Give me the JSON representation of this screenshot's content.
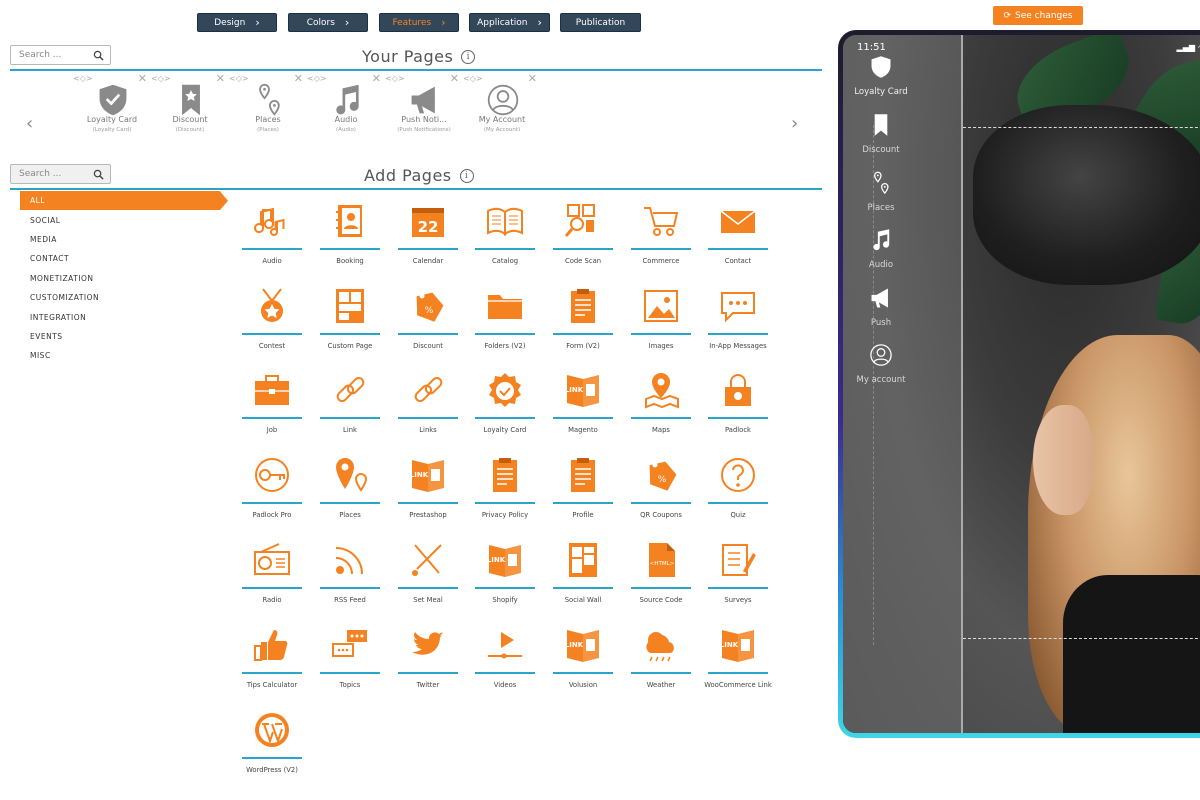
{
  "nav": {
    "steps": [
      {
        "label": "Design",
        "active": false
      },
      {
        "label": "Colors",
        "active": false
      },
      {
        "label": "Features",
        "active": true
      },
      {
        "label": "Application",
        "active": false
      },
      {
        "label": "Publication",
        "active": false
      }
    ],
    "see_changes": "See changes"
  },
  "search_top": {
    "placeholder": "Search ..."
  },
  "search_bottom": {
    "placeholder": "Search ..."
  },
  "your_pages": {
    "title": "Your Pages",
    "items": [
      {
        "label": "Loyalty Card",
        "sub": "(Loyalty Card)",
        "icon": "shield-check-icon"
      },
      {
        "label": "Discount",
        "sub": "(Discount)",
        "icon": "bookmark-star-icon"
      },
      {
        "label": "Places",
        "sub": "(Places)",
        "icon": "map-pins-icon"
      },
      {
        "label": "Audio",
        "sub": "(Audio)",
        "icon": "music-note-icon"
      },
      {
        "label": "Push Noti...",
        "sub": "(Push Notifications)",
        "icon": "megaphone-icon"
      },
      {
        "label": "My Account",
        "sub": "(My Account)",
        "icon": "user-circle-icon"
      }
    ]
  },
  "add_pages": {
    "title": "Add Pages",
    "categories": [
      "ALL",
      "SOCIAL",
      "MEDIA",
      "CONTACT",
      "MONETIZATION",
      "CUSTOMIZATION",
      "INTEGRATION",
      "EVENTS",
      "MISC"
    ],
    "active_category": "ALL",
    "tiles": [
      {
        "label": "Audio",
        "icon": "music-notes-icon"
      },
      {
        "label": "Booking",
        "icon": "address-book-icon"
      },
      {
        "label": "Calendar",
        "icon": "calendar-icon",
        "text": "22"
      },
      {
        "label": "Catalog",
        "icon": "open-book-icon"
      },
      {
        "label": "Code Scan",
        "icon": "qr-scan-icon"
      },
      {
        "label": "Commerce",
        "icon": "shopping-cart-icon"
      },
      {
        "label": "Contact",
        "icon": "envelope-icon"
      },
      {
        "label": "Contest",
        "icon": "medal-icon"
      },
      {
        "label": "Custom Page",
        "icon": "layout-icon"
      },
      {
        "label": "Discount",
        "icon": "price-tag-icon"
      },
      {
        "label": "Folders (V2)",
        "icon": "folder-icon"
      },
      {
        "label": "Form (V2)",
        "icon": "clipboard-form-icon"
      },
      {
        "label": "Images",
        "icon": "image-icon"
      },
      {
        "label": "In-App Messages",
        "icon": "chat-bubble-icon"
      },
      {
        "label": "Job",
        "icon": "briefcase-icon"
      },
      {
        "label": "Link",
        "icon": "chain-link-icon"
      },
      {
        "label": "Links",
        "icon": "chain-links-icon"
      },
      {
        "label": "Loyalty Card",
        "icon": "badge-check-icon"
      },
      {
        "label": "Magento",
        "icon": "magento-link-icon"
      },
      {
        "label": "Maps",
        "icon": "map-marker-icon"
      },
      {
        "label": "Padlock",
        "icon": "padlock-icon"
      },
      {
        "label": "Padlock Pro",
        "icon": "key-circle-icon"
      },
      {
        "label": "Places",
        "icon": "places-pin-icon"
      },
      {
        "label": "Prestashop",
        "icon": "prestashop-link-icon"
      },
      {
        "label": "Privacy Policy",
        "icon": "document-list-icon"
      },
      {
        "label": "Profile",
        "icon": "profile-clipboard-icon"
      },
      {
        "label": "QR Coupons",
        "icon": "coupon-tag-icon"
      },
      {
        "label": "Quiz",
        "icon": "question-circle-icon"
      },
      {
        "label": "Radio",
        "icon": "radio-icon"
      },
      {
        "label": "RSS Feed",
        "icon": "rss-icon"
      },
      {
        "label": "Set Meal",
        "icon": "utensils-icon"
      },
      {
        "label": "Shopify",
        "icon": "shopify-link-icon"
      },
      {
        "label": "Social Wall",
        "icon": "social-wall-icon"
      },
      {
        "label": "Source Code",
        "icon": "html-file-icon"
      },
      {
        "label": "Surveys",
        "icon": "survey-pencil-icon"
      },
      {
        "label": "Tips Calculator",
        "icon": "thumbs-up-icon"
      },
      {
        "label": "Topics",
        "icon": "topics-bubbles-icon"
      },
      {
        "label": "Twitter",
        "icon": "twitter-bird-icon"
      },
      {
        "label": "Videos",
        "icon": "video-play-icon"
      },
      {
        "label": "Volusion",
        "icon": "volusion-link-icon"
      },
      {
        "label": "Weather",
        "icon": "weather-cloud-icon"
      },
      {
        "label": "WooCommerce Link",
        "icon": "woocommerce-link-icon"
      },
      {
        "label": "WordPress (V2)",
        "icon": "wordpress-icon"
      }
    ]
  },
  "phone": {
    "time": "11:51",
    "menu": [
      {
        "label": "Loyalty Card",
        "icon": "shield-check-icon"
      },
      {
        "label": "Discount",
        "icon": "bookmark-star-icon"
      },
      {
        "label": "Places",
        "icon": "map-pins-icon"
      },
      {
        "label": "Audio",
        "icon": "music-note-icon"
      },
      {
        "label": "Push",
        "icon": "megaphone-icon"
      },
      {
        "label": "My account",
        "icon": "user-circle-icon"
      }
    ]
  },
  "colors": {
    "accent": "#f58220",
    "nav": "#33475b",
    "rule": "#2aa4c8"
  }
}
